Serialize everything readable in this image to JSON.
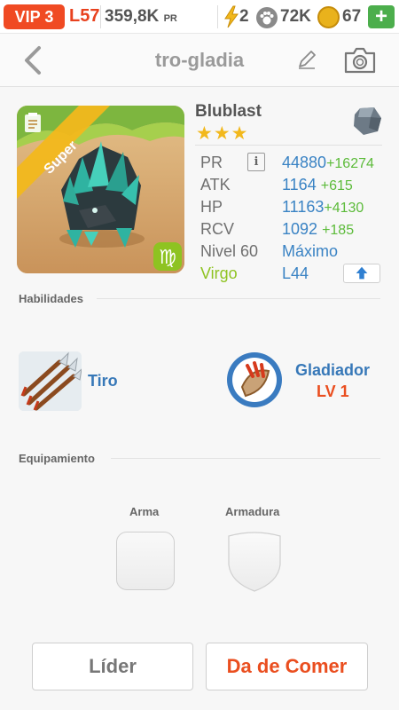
{
  "statusbar": {
    "vip": "VIP 3",
    "level": "L57",
    "pr_value": "359,8K",
    "pr_unit": "PR",
    "energy": "2",
    "paws": "72K",
    "coins": "67",
    "add_label": "+"
  },
  "header": {
    "title": "tro-gladia",
    "back_icon": "chevron-left-icon",
    "edit_icon": "pencil-icon",
    "camera_icon": "camera-icon"
  },
  "monster": {
    "rarity_ribbon": "Super",
    "name": "Blublast",
    "stars": "★★★",
    "star_count": 3,
    "element_icon": "rock-element-icon",
    "stats": [
      {
        "label": "PR",
        "value": "44880",
        "bonus": "+16274"
      },
      {
        "label": "ATK",
        "value": "1164",
        "bonus": "+615"
      },
      {
        "label": "HP",
        "value": "11163",
        "bonus": "+4130"
      },
      {
        "label": "RCV",
        "value": "1092",
        "bonus": "+185"
      }
    ],
    "level_label": "Nivel 60",
    "level_value": "Máximo",
    "sign_label": "Virgo",
    "sign_value": "L44",
    "colors": {
      "value": "#3a83c4",
      "bonus": "#5cbb3a",
      "virgo": "#8ec321",
      "accent": "#ea4e1f"
    }
  },
  "abilities": {
    "title": "Habilidades",
    "skill1": {
      "name": "Tiro",
      "icon": "arrows-icon"
    },
    "skill2": {
      "name": "Gladiador",
      "level": "LV 1",
      "icon": "gladiator-shield-icon"
    }
  },
  "equipment": {
    "title": "Equipamiento",
    "weapon_label": "Arma",
    "armor_label": "Armadura"
  },
  "buttons": {
    "leader": "Líder",
    "feed": "Da de Comer"
  }
}
